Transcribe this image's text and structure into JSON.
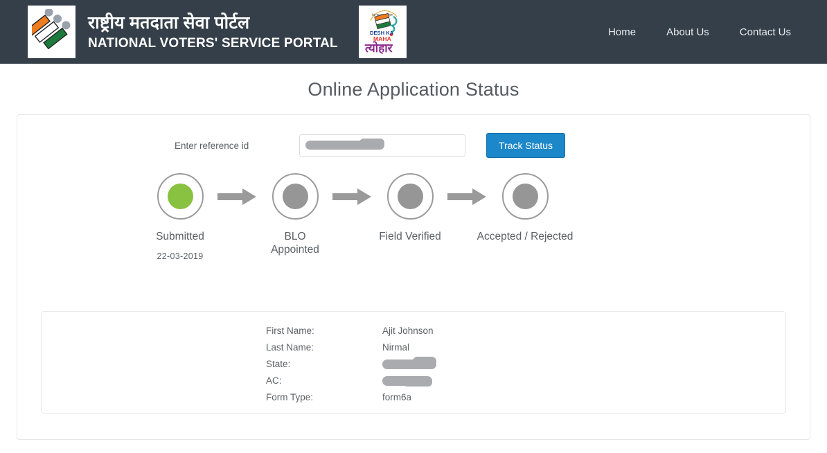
{
  "header": {
    "brand_hindi": "राष्ट्रीय मतदाता सेवा पोर्टल",
    "brand_english": "NATIONAL VOTERS' SERVICE PORTAL",
    "left_logo_name": "eci-ballot-logo",
    "right_logo_name": "desh-ka-maha-tyohar-logo",
    "right_logo_text_top": "देश का महा त्योहार",
    "right_logo_text_en1": "DESH KA",
    "right_logo_text_en2": "MAHA",
    "background_color": "#343f49",
    "nav": [
      {
        "label": "Home"
      },
      {
        "label": "About Us"
      },
      {
        "label": "Contact Us"
      }
    ]
  },
  "page": {
    "title": "Online Application Status"
  },
  "search": {
    "label": "Enter reference id",
    "value": "",
    "placeholder": "",
    "redacted": true,
    "button_label": "Track Status",
    "button_color": "#1c87c9"
  },
  "stepper": {
    "active_color": "#88c240",
    "inactive_color": "#969696",
    "steps": [
      {
        "label": "Submitted",
        "date": "22-03-2019",
        "state": "completed"
      },
      {
        "label": "BLO\nAppointed",
        "date": "",
        "state": "pending"
      },
      {
        "label": "Field Verified",
        "date": "",
        "state": "pending"
      },
      {
        "label": "Accepted / Rejected",
        "date": "",
        "state": "pending"
      }
    ],
    "arrow_icon": "arrow-right-icon"
  },
  "details": {
    "rows": [
      {
        "key": "First Name:",
        "value": "Ajit Johnson",
        "redacted": false
      },
      {
        "key": "Last Name:",
        "value": "Nirmal",
        "redacted": false
      },
      {
        "key": "State:",
        "value": "",
        "redacted": true
      },
      {
        "key": "AC:",
        "value": "",
        "redacted": true
      },
      {
        "key": "Form Type:",
        "value": "form6a",
        "redacted": false
      }
    ]
  }
}
